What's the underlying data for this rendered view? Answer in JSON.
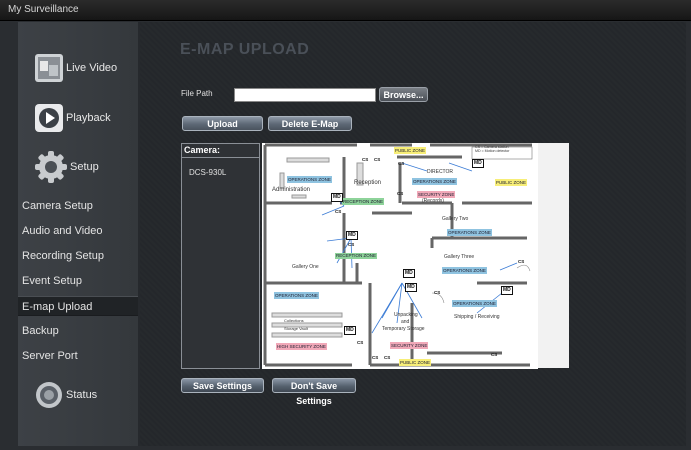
{
  "window": {
    "title": "My Surveillance"
  },
  "sidebar": {
    "main": [
      {
        "label": "Live Video",
        "icon": "live-video-icon"
      },
      {
        "label": "Playback",
        "icon": "playback-icon"
      },
      {
        "label": "Setup",
        "icon": "gear-icon"
      },
      {
        "label": "Status",
        "icon": "status-icon"
      }
    ],
    "setup_items": [
      {
        "label": "Camera Setup"
      },
      {
        "label": "Audio and Video"
      },
      {
        "label": "Recording Setup"
      },
      {
        "label": "Event Setup"
      },
      {
        "label": "E-map Upload",
        "active": true
      },
      {
        "label": "Backup"
      },
      {
        "label": "Server Port"
      }
    ]
  },
  "page": {
    "title": "E-MAP UPLOAD",
    "file_path_label": "File Path",
    "file_path_value": "",
    "browse_label": "Browse...",
    "upload_label": "Upload",
    "delete_label": "Delete E-Map",
    "save_label": "Save Settings",
    "dont_save_label": "Don't Save Settings"
  },
  "camera_panel": {
    "header": "Camera:",
    "cameras": [
      "DCS-930L"
    ]
  },
  "emap": {
    "legend": [
      "CS = Camera station",
      "MD = Motion detector"
    ],
    "rooms": {
      "administration": "Administration",
      "reception": "Reception",
      "director": "DIRECTOR",
      "records": "(Records)",
      "gallery_two": "Gallery Two",
      "gallery_one": "Gallery One",
      "gallery_three": "Gallery Three",
      "unpacking": "Unpacking",
      "and": "and",
      "temp_storage": "Temporary Storage",
      "shipping": "Shipping / Receiving",
      "collections": "Collections",
      "storage_vault": "Storage Vault"
    },
    "zones": {
      "public1": "PUBLIC ZONE",
      "operations_admin": "OPERATIONS ZONE",
      "reception_zone": "RECEPTION ZONE",
      "operations_director": "OPERATIONS ZONE",
      "security_zone_records": "SECURITY ZONE",
      "public_right": "PUBLIC ZONE",
      "operations_g2": "OPERATIONS ZONE",
      "reception_mid": "RECEPTION ZONE",
      "operations_g3": "OPERATIONS ZONE",
      "operations_g1": "OPERATIONS ZONE",
      "operations_ship": "OPERATIONS ZONE",
      "high_security": "HIGH SECURITY ZONE",
      "security_bottom": "SECURITY ZONE",
      "public_bottom": "PUBLIC ZONE"
    },
    "marker_md": "MD",
    "marker_cs": "CS"
  },
  "colors": {
    "zone_blue": "#8fc3e0",
    "zone_green": "#8ed39a",
    "zone_yellow": "#f7ee78",
    "zone_pink": "#f1a8b8"
  }
}
